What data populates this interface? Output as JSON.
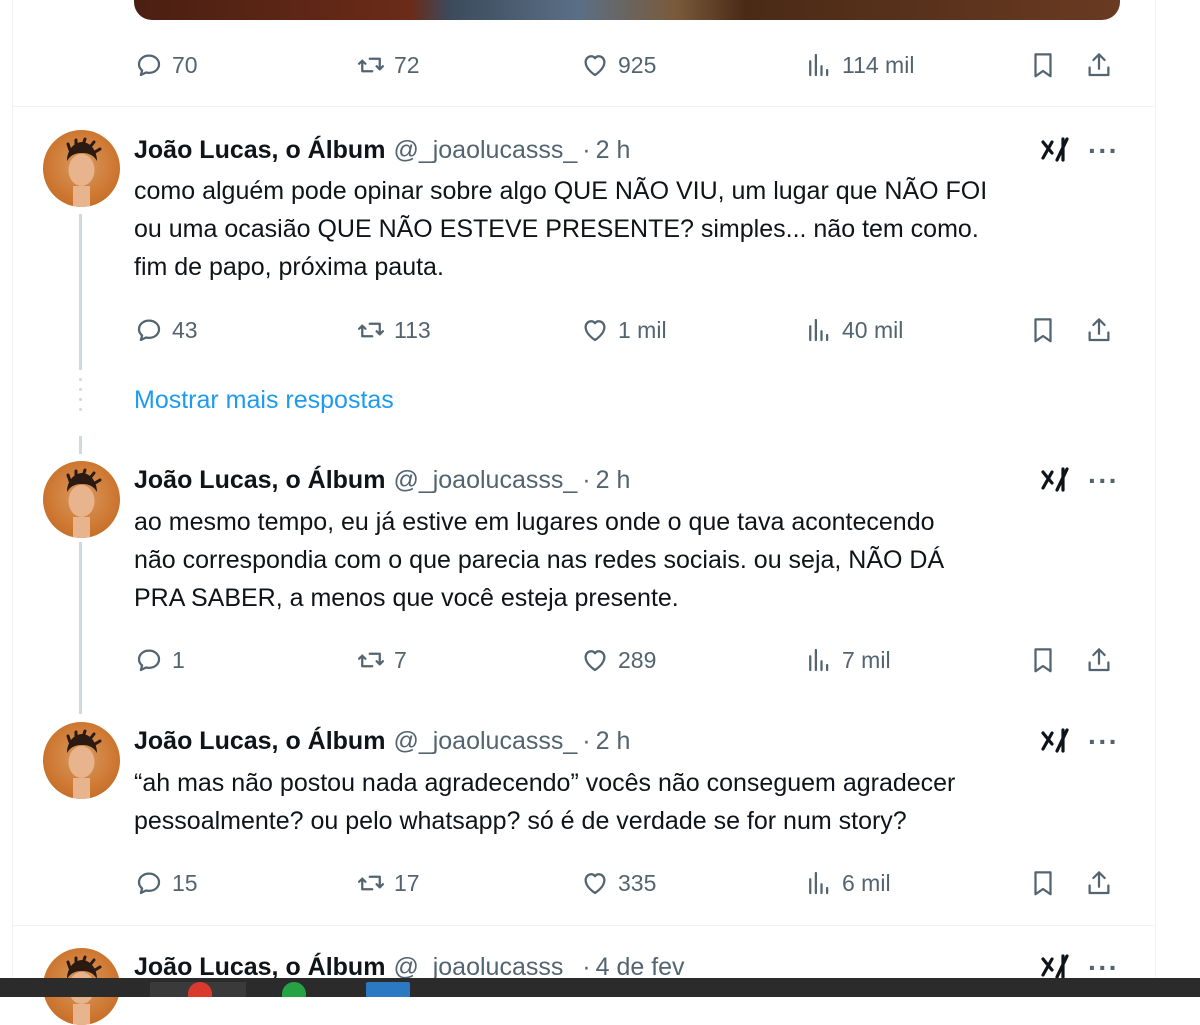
{
  "app": {
    "name": "X"
  },
  "top_tweet": {
    "stats": {
      "replies": "70",
      "retweets": "72",
      "likes": "925",
      "views": "114 mil"
    }
  },
  "thread": {
    "show_more_label": "Mostrar mais respostas",
    "tweets": [
      {
        "name": "João Lucas, o Álbum",
        "handle": "@_joaolucasss_",
        "separator": "·",
        "time": "2 h",
        "text": "como alguém pode opinar sobre algo QUE NÃO VIU, um lugar que NÃO FOI\nou uma ocasião QUE NÃO ESTEVE PRESENTE? simples... não tem como.\nfim de papo, próxima pauta.",
        "stats": {
          "replies": "43",
          "retweets": "113",
          "likes": "1 mil",
          "views": "40 mil"
        }
      },
      {
        "name": "João Lucas, o Álbum",
        "handle": "@_joaolucasss_",
        "separator": "·",
        "time": "2 h",
        "text": "ao mesmo tempo, eu já estive em lugares onde o que tava acontecendo\nnão correspondia com o que parecia nas redes sociais. ou seja, NÃO DÁ\nPRA SABER, a menos que você esteja presente.",
        "stats": {
          "replies": "1",
          "retweets": "7",
          "likes": "289",
          "views": "7 mil"
        }
      },
      {
        "name": "João Lucas, o Álbum",
        "handle": "@_joaolucasss_",
        "separator": "·",
        "time": "2 h",
        "text": "“ah mas não postou nada agradecendo” vocês não conseguem agradecer\npessoalmente? ou pelo whatsapp? só é de verdade se for num story?",
        "stats": {
          "replies": "15",
          "retweets": "17",
          "likes": "335",
          "views": "6 mil"
        }
      },
      {
        "name": "João Lucas, o Álbum",
        "handle": "@_joaolucasss_",
        "separator": "·",
        "time": "4 de fev"
      }
    ]
  },
  "icons": {
    "reply": "reply-icon",
    "retweet": "retweet-icon",
    "like": "heart-icon",
    "views": "views-icon",
    "bookmark": "bookmark-icon",
    "share": "share-icon",
    "grok": "grok-icon",
    "more": "more-icon"
  },
  "colors": {
    "accent": "#1d9bf0",
    "muted": "#536471",
    "text": "#0f1419",
    "line": "#cfd9de"
  }
}
